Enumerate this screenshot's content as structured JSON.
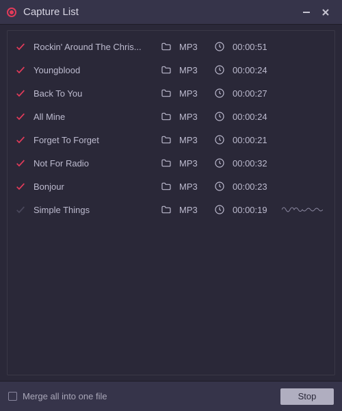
{
  "window": {
    "title": "Capture List"
  },
  "tracks": [
    {
      "title": "Rockin' Around The Chris...",
      "format": "MP3",
      "duration": "00:00:51",
      "completed": true,
      "recording": false
    },
    {
      "title": "Youngblood",
      "format": "MP3",
      "duration": "00:00:24",
      "completed": true,
      "recording": false
    },
    {
      "title": "Back To You",
      "format": "MP3",
      "duration": "00:00:27",
      "completed": true,
      "recording": false
    },
    {
      "title": "All Mine",
      "format": "MP3",
      "duration": "00:00:24",
      "completed": true,
      "recording": false
    },
    {
      "title": "Forget To Forget",
      "format": "MP3",
      "duration": "00:00:21",
      "completed": true,
      "recording": false
    },
    {
      "title": "Not For Radio",
      "format": "MP3",
      "duration": "00:00:32",
      "completed": true,
      "recording": false
    },
    {
      "title": "Bonjour",
      "format": "MP3",
      "duration": "00:00:23",
      "completed": true,
      "recording": false
    },
    {
      "title": "Simple Things",
      "format": "MP3",
      "duration": "00:00:19",
      "completed": false,
      "recording": true
    }
  ],
  "footer": {
    "merge_label": "Merge all into one file",
    "stop_label": "Stop"
  }
}
